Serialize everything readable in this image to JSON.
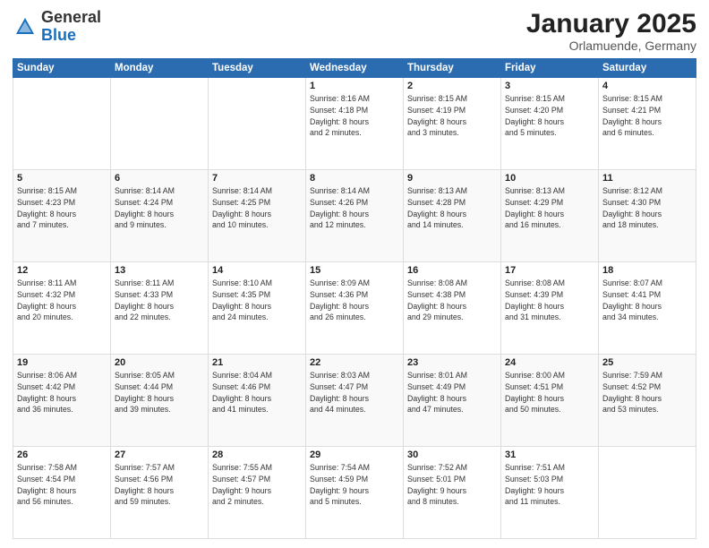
{
  "logo": {
    "general": "General",
    "blue": "Blue"
  },
  "header": {
    "month": "January 2025",
    "location": "Orlamuende, Germany"
  },
  "weekdays": [
    "Sunday",
    "Monday",
    "Tuesday",
    "Wednesday",
    "Thursday",
    "Friday",
    "Saturday"
  ],
  "weeks": [
    [
      {
        "day": "",
        "info": ""
      },
      {
        "day": "",
        "info": ""
      },
      {
        "day": "",
        "info": ""
      },
      {
        "day": "1",
        "info": "Sunrise: 8:16 AM\nSunset: 4:18 PM\nDaylight: 8 hours\nand 2 minutes."
      },
      {
        "day": "2",
        "info": "Sunrise: 8:15 AM\nSunset: 4:19 PM\nDaylight: 8 hours\nand 3 minutes."
      },
      {
        "day": "3",
        "info": "Sunrise: 8:15 AM\nSunset: 4:20 PM\nDaylight: 8 hours\nand 5 minutes."
      },
      {
        "day": "4",
        "info": "Sunrise: 8:15 AM\nSunset: 4:21 PM\nDaylight: 8 hours\nand 6 minutes."
      }
    ],
    [
      {
        "day": "5",
        "info": "Sunrise: 8:15 AM\nSunset: 4:23 PM\nDaylight: 8 hours\nand 7 minutes."
      },
      {
        "day": "6",
        "info": "Sunrise: 8:14 AM\nSunset: 4:24 PM\nDaylight: 8 hours\nand 9 minutes."
      },
      {
        "day": "7",
        "info": "Sunrise: 8:14 AM\nSunset: 4:25 PM\nDaylight: 8 hours\nand 10 minutes."
      },
      {
        "day": "8",
        "info": "Sunrise: 8:14 AM\nSunset: 4:26 PM\nDaylight: 8 hours\nand 12 minutes."
      },
      {
        "day": "9",
        "info": "Sunrise: 8:13 AM\nSunset: 4:28 PM\nDaylight: 8 hours\nand 14 minutes."
      },
      {
        "day": "10",
        "info": "Sunrise: 8:13 AM\nSunset: 4:29 PM\nDaylight: 8 hours\nand 16 minutes."
      },
      {
        "day": "11",
        "info": "Sunrise: 8:12 AM\nSunset: 4:30 PM\nDaylight: 8 hours\nand 18 minutes."
      }
    ],
    [
      {
        "day": "12",
        "info": "Sunrise: 8:11 AM\nSunset: 4:32 PM\nDaylight: 8 hours\nand 20 minutes."
      },
      {
        "day": "13",
        "info": "Sunrise: 8:11 AM\nSunset: 4:33 PM\nDaylight: 8 hours\nand 22 minutes."
      },
      {
        "day": "14",
        "info": "Sunrise: 8:10 AM\nSunset: 4:35 PM\nDaylight: 8 hours\nand 24 minutes."
      },
      {
        "day": "15",
        "info": "Sunrise: 8:09 AM\nSunset: 4:36 PM\nDaylight: 8 hours\nand 26 minutes."
      },
      {
        "day": "16",
        "info": "Sunrise: 8:08 AM\nSunset: 4:38 PM\nDaylight: 8 hours\nand 29 minutes."
      },
      {
        "day": "17",
        "info": "Sunrise: 8:08 AM\nSunset: 4:39 PM\nDaylight: 8 hours\nand 31 minutes."
      },
      {
        "day": "18",
        "info": "Sunrise: 8:07 AM\nSunset: 4:41 PM\nDaylight: 8 hours\nand 34 minutes."
      }
    ],
    [
      {
        "day": "19",
        "info": "Sunrise: 8:06 AM\nSunset: 4:42 PM\nDaylight: 8 hours\nand 36 minutes."
      },
      {
        "day": "20",
        "info": "Sunrise: 8:05 AM\nSunset: 4:44 PM\nDaylight: 8 hours\nand 39 minutes."
      },
      {
        "day": "21",
        "info": "Sunrise: 8:04 AM\nSunset: 4:46 PM\nDaylight: 8 hours\nand 41 minutes."
      },
      {
        "day": "22",
        "info": "Sunrise: 8:03 AM\nSunset: 4:47 PM\nDaylight: 8 hours\nand 44 minutes."
      },
      {
        "day": "23",
        "info": "Sunrise: 8:01 AM\nSunset: 4:49 PM\nDaylight: 8 hours\nand 47 minutes."
      },
      {
        "day": "24",
        "info": "Sunrise: 8:00 AM\nSunset: 4:51 PM\nDaylight: 8 hours\nand 50 minutes."
      },
      {
        "day": "25",
        "info": "Sunrise: 7:59 AM\nSunset: 4:52 PM\nDaylight: 8 hours\nand 53 minutes."
      }
    ],
    [
      {
        "day": "26",
        "info": "Sunrise: 7:58 AM\nSunset: 4:54 PM\nDaylight: 8 hours\nand 56 minutes."
      },
      {
        "day": "27",
        "info": "Sunrise: 7:57 AM\nSunset: 4:56 PM\nDaylight: 8 hours\nand 59 minutes."
      },
      {
        "day": "28",
        "info": "Sunrise: 7:55 AM\nSunset: 4:57 PM\nDaylight: 9 hours\nand 2 minutes."
      },
      {
        "day": "29",
        "info": "Sunrise: 7:54 AM\nSunset: 4:59 PM\nDaylight: 9 hours\nand 5 minutes."
      },
      {
        "day": "30",
        "info": "Sunrise: 7:52 AM\nSunset: 5:01 PM\nDaylight: 9 hours\nand 8 minutes."
      },
      {
        "day": "31",
        "info": "Sunrise: 7:51 AM\nSunset: 5:03 PM\nDaylight: 9 hours\nand 11 minutes."
      },
      {
        "day": "",
        "info": ""
      }
    ]
  ]
}
